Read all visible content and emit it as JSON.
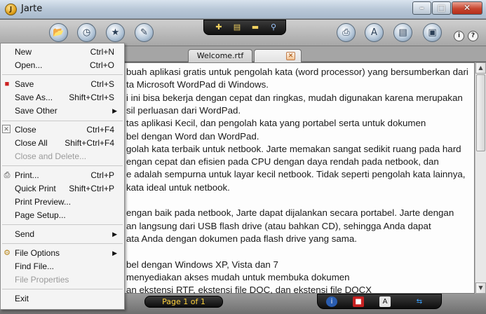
{
  "window": {
    "title": "Jarte",
    "app_icon_letter": "J"
  },
  "toolbar": {
    "left_buttons": [
      "open-icon",
      "clock-icon",
      "star-icon",
      "edit-icon"
    ],
    "right_buttons": [
      "print-icon",
      "font-icon",
      "doc-icon",
      "paste-icon"
    ],
    "info_label": "i",
    "help_label": "?"
  },
  "tabs": [
    {
      "label": "Welcome.rtf"
    },
    {
      "label": ""
    }
  ],
  "document": {
    "lines": [
      "buah aplikasi gratis untuk pengolah kata (word processor) yang bersumberkan dari",
      "ta Microsoft WordPad di Windows.",
      "i ini bisa bekerja dengan cepat dan ringkas, mudah digunakan karena merupakan",
      "sil perluasan dari  WordPad.",
      "tas aplikasi Kecil, dan pengolah kata yang portabel serta untuk dokumen",
      "bel dengan Word dan WordPad.",
      "golah kata terbaik untuk netbook. Jarte memakan sangat sedikit ruang pada hard",
      "engan cepat dan efisien pada CPU dengan daya rendah pada netbook, dan",
      "e adalah sempurna untuk layar kecil netbook. Tidak seperti pengolah kata lainnya,",
      " kata ideal untuk netbook.",
      "",
      "engan baik pada netbook, Jarte dapat dijalankan secara portabel. Jarte dengan",
      "an langsung dari USB flash drive (atau bahkan CD), sehingga Anda dapat",
      "ata Anda dengan dokumen pada flash drive yang sama.",
      "",
      "bel dengan Windows XP, Vista dan 7",
      "menyediakan akses mudah untuk membuka dokumen",
      "an ekstensi RTF, ekstensi file DOC, dan ekstensi file DOCX"
    ]
  },
  "statusbar": {
    "page": "Page 1 of 1"
  },
  "menu": {
    "items": [
      {
        "label": "New",
        "shortcut": "Ctrl+N"
      },
      {
        "label": "Open...",
        "shortcut": "Ctrl+O"
      },
      {
        "label": "Save",
        "shortcut": "Ctrl+S"
      },
      {
        "label": "Save As...",
        "shortcut": "Shift+Ctrl+S"
      },
      {
        "label": "Save Other",
        "shortcut": ""
      },
      {
        "label": "Close",
        "shortcut": "Ctrl+F4"
      },
      {
        "label": "Close All",
        "shortcut": "Shift+Ctrl+F4"
      },
      {
        "label": "Close and Delete...",
        "shortcut": ""
      },
      {
        "label": "Print...",
        "shortcut": "Ctrl+P"
      },
      {
        "label": "Quick Print",
        "shortcut": "Shift+Ctrl+P"
      },
      {
        "label": "Print Preview...",
        "shortcut": ""
      },
      {
        "label": "Page Setup...",
        "shortcut": ""
      },
      {
        "label": "Send",
        "shortcut": ""
      },
      {
        "label": "File Options",
        "shortcut": ""
      },
      {
        "label": "Find File...",
        "shortcut": ""
      },
      {
        "label": "File Properties",
        "shortcut": ""
      },
      {
        "label": "Exit",
        "shortcut": ""
      }
    ]
  },
  "colors": {
    "page_indicator_text": "#ffd23c",
    "save_icon": "#cc2222"
  }
}
